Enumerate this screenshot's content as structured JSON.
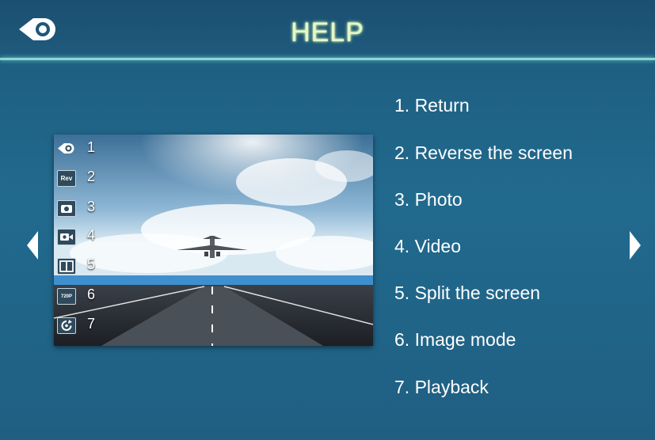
{
  "header": {
    "title": "HELP",
    "back_icon": "return-icon"
  },
  "colors": {
    "background": "#216a8e",
    "header_bg": "#1b4f71",
    "accent_line": "#8fd6cf",
    "title_glow": "#c7ff9a"
  },
  "navigation": {
    "prev_icon": "left-arrow-icon",
    "next_icon": "right-arrow-icon"
  },
  "preview": {
    "toolbar": [
      {
        "num": "1",
        "icon": "return-icon",
        "label": ""
      },
      {
        "num": "2",
        "icon": "reverse-icon",
        "label": "Rev"
      },
      {
        "num": "3",
        "icon": "camera-icon",
        "label": ""
      },
      {
        "num": "4",
        "icon": "video-icon",
        "label": ""
      },
      {
        "num": "5",
        "icon": "split-screen-icon",
        "label": ""
      },
      {
        "num": "6",
        "icon": "image-mode-icon",
        "label": "720P"
      },
      {
        "num": "7",
        "icon": "playback-icon",
        "label": ""
      }
    ]
  },
  "help_items": [
    {
      "text": "1. Return"
    },
    {
      "text": "2. Reverse the screen"
    },
    {
      "text": "3. Photo"
    },
    {
      "text": "4. Video"
    },
    {
      "text": "5. Split the screen"
    },
    {
      "text": "6. Image mode"
    },
    {
      "text": "7. Playback"
    }
  ]
}
